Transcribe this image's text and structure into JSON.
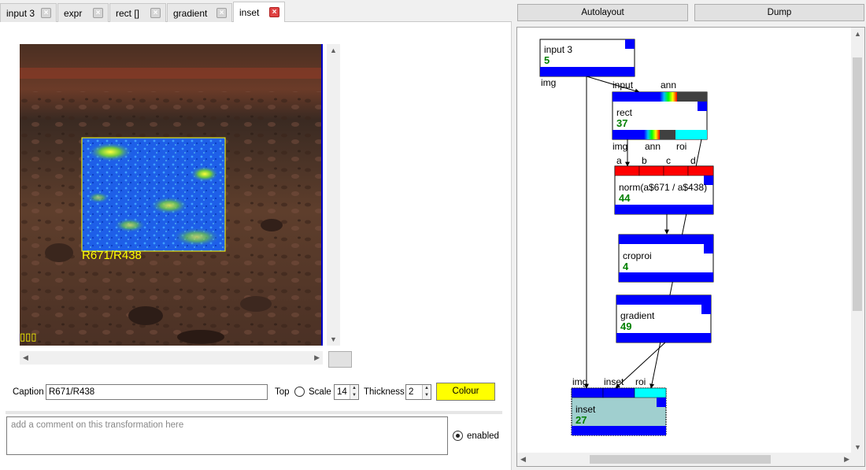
{
  "tabs": [
    {
      "label": "input 3",
      "close": "×",
      "active": false
    },
    {
      "label": "expr",
      "close": "×",
      "active": false
    },
    {
      "label": "rect []",
      "close": "×",
      "active": false
    },
    {
      "label": "gradient",
      "close": "×",
      "active": false
    },
    {
      "label": "inset",
      "close": "×",
      "active": true
    }
  ],
  "image": {
    "overlay_caption": "R671/R438",
    "corner_marks": "▯▯▯",
    "border_color": "#0000cc",
    "caption_color": "#ffff00"
  },
  "controls": {
    "caption_label": "Caption",
    "caption_value": "R671/R438",
    "top_label": "Top",
    "top_checked": false,
    "scale_label": "Scale",
    "scale_value": "14",
    "thickness_label": "Thickness",
    "thickness_value": "2",
    "colour_button": "Colour",
    "colour_value": "#ffff00"
  },
  "comment": {
    "placeholder": "add a comment on this transformation here"
  },
  "enabled": {
    "label": "enabled",
    "checked": true
  },
  "toolbar": {
    "autolayout": "Autolayout",
    "dump": "Dump"
  },
  "graph": {
    "nodes": {
      "input": {
        "title": "input 3",
        "number": "5",
        "out_label": "img"
      },
      "rect": {
        "title": "rect",
        "number": "37",
        "in1": "input",
        "in2": "ann",
        "out1": "img",
        "out2": "ann",
        "out3": "roi"
      },
      "norm": {
        "title": "norm(a$671 / a$438)",
        "number": "44",
        "in1": "a",
        "in2": "b",
        "in3": "c",
        "in4": "d"
      },
      "croproi": {
        "title": "croproi",
        "number": "4"
      },
      "gradient": {
        "title": "gradient",
        "number": "49"
      },
      "inset": {
        "title": "inset",
        "number": "27",
        "in1": "img",
        "in2": "inset",
        "in3": "roi"
      }
    },
    "colors": {
      "connector": "#0000ff",
      "roi": "#00ffff",
      "expr_input": "#ff0000",
      "selected_node": "#a0cfcf",
      "number": "#008000"
    }
  },
  "scroll_arrows": {
    "up": "▲",
    "down": "▼",
    "left": "◀",
    "right": "▶"
  }
}
